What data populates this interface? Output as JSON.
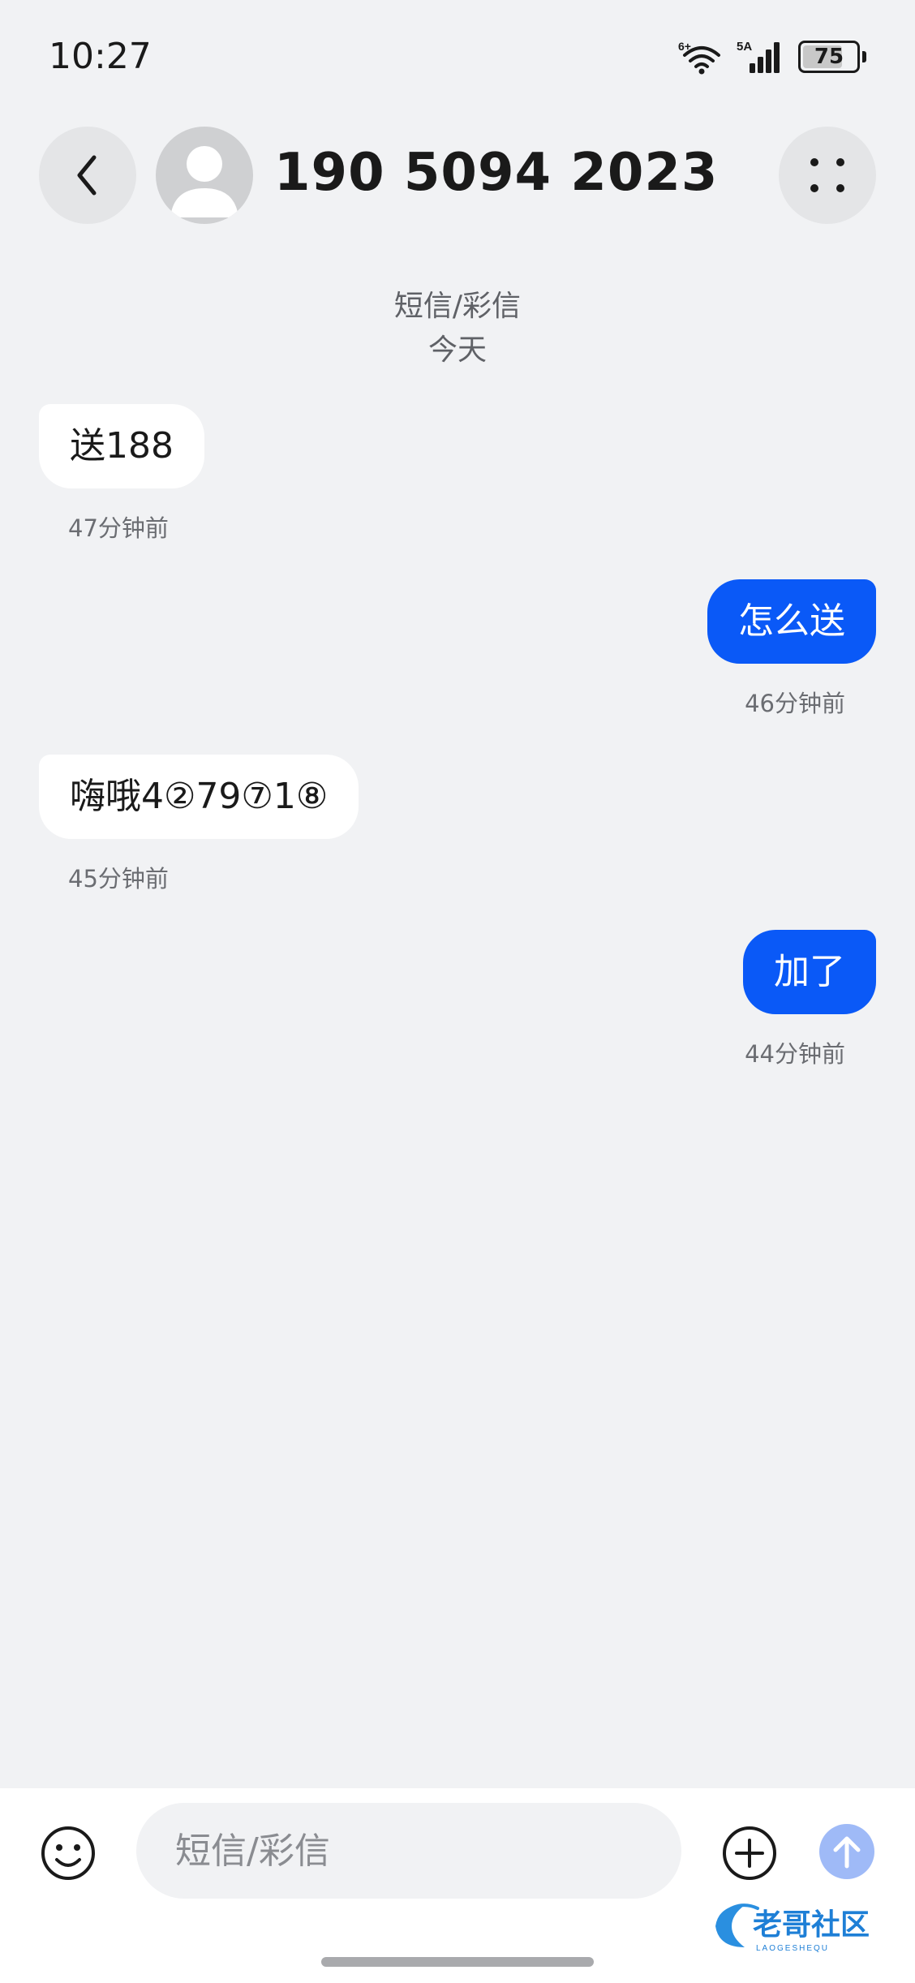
{
  "status_bar": {
    "time": "10:27",
    "wifi_badge": "6+",
    "network_label": "5A",
    "battery_level": 75,
    "battery_text": "75"
  },
  "header": {
    "title": "190 5094 2023",
    "back_icon": "chevron-left-icon",
    "more_icon": "dots-grid-icon"
  },
  "conversation": {
    "channel": "短信/彩信",
    "day": "今天"
  },
  "messages": [
    {
      "direction": "in",
      "text": "送188",
      "time": "47分钟前"
    },
    {
      "direction": "out",
      "text": "怎么送",
      "time": "46分钟前"
    },
    {
      "direction": "in",
      "text": "嗨哦4②79⑦1⑧",
      "time": "45分钟前"
    },
    {
      "direction": "out",
      "text": "加了",
      "time": "44分钟前"
    }
  ],
  "composer": {
    "placeholder": "短信/彩信",
    "emoji_icon": "emoji-icon",
    "add_icon": "plus-circle-icon",
    "send_icon": "arrow-up-icon"
  },
  "watermark": {
    "text": "老哥社区",
    "subtext": "LAOGESHEQU"
  },
  "colors": {
    "background": "#f1f2f4",
    "outgoing_bubble": "#0a59f7",
    "incoming_bubble": "#ffffff",
    "send_button": "#9fbaf7"
  }
}
